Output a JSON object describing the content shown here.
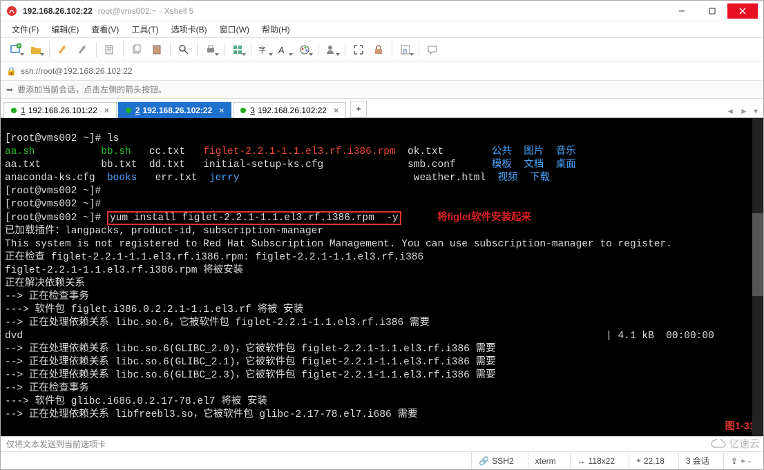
{
  "titlebar": {
    "main": "192.168.26.102:22",
    "sub": "root@vms002:~ - Xshell 5"
  },
  "menu": {
    "file": "文件(F)",
    "edit": "编辑(E)",
    "view": "查看(V)",
    "tools": "工具(T)",
    "tabs": "选项卡(B)",
    "window": "窗口(W)",
    "help": "帮助(H)"
  },
  "addr": {
    "url": "ssh://root@192.168.26.102:22"
  },
  "hint": {
    "text": "要添加当前会话，点击左侧的箭头按钮。"
  },
  "tabs": {
    "items": [
      {
        "num": "1",
        "label": "192.168.26.101:22"
      },
      {
        "num": "2",
        "label": "192.168.26.102:22"
      },
      {
        "num": "3",
        "label": "192.168.26.102:22"
      }
    ]
  },
  "term": {
    "prompt": "[root@vms002 ~]#",
    "cmd_ls": "ls",
    "row1": {
      "c1": "aa.sh",
      "c2": "bb.sh",
      "c3": "cc.txt",
      "c4": "figlet-2.2.1-1.1.el3.rf.i386.rpm",
      "c5": "ok.txt",
      "c6": "公共",
      "c7": "图片",
      "c8": "音乐"
    },
    "row2": {
      "c1": "aa.txt",
      "c2": "bb.txt",
      "c3": "dd.txt",
      "c4": "initial-setup-ks.cfg",
      "c5": "smb.conf",
      "c6": "模板",
      "c7": "文档",
      "c8": "桌面"
    },
    "row3": {
      "c1": "anaconda-ks.cfg",
      "c2": "books",
      "c3": "err.txt",
      "c4": "jerry",
      "c5": "weather.html",
      "c6": "视频",
      "c7": "下载"
    },
    "yum_cmd": "yum install figlet-2.2.1-1.1.el3.rf.i386.rpm  -y",
    "annot": "将figlet软件安装起来",
    "lines": [
      "已加载插件：langpacks, product-id, subscription-manager",
      "This system is not registered to Red Hat Subscription Management. You can use subscription-manager to register.",
      "正在检查 figlet-2.2.1-1.1.el3.rf.i386.rpm: figlet-2.2.1-1.1.el3.rf.i386",
      "figlet-2.2.1-1.1.el3.rf.i386.rpm 将被安装",
      "正在解决依赖关系",
      "--> 正在检查事务",
      "---> 软件包 figlet.i386.0.2.2.1-1.1.el3.rf 将被 安装",
      "--> 正在处理依赖关系 libc.so.6，它被软件包 figlet-2.2.1-1.1.el3.rf.i386 需要"
    ],
    "dvd_left": "dvd",
    "dvd_right": "| 4.1 kB  00:00:00",
    "lines2": [
      "--> 正在处理依赖关系 libc.so.6(GLIBC_2.0)，它被软件包 figlet-2.2.1-1.1.el3.rf.i386 需要",
      "--> 正在处理依赖关系 libc.so.6(GLIBC_2.1)，它被软件包 figlet-2.2.1-1.1.el3.rf.i386 需要",
      "--> 正在处理依赖关系 libc.so.6(GLIBC_2.3)，它被软件包 figlet-2.2.1-1.1.el3.rf.i386 需要",
      "--> 正在检查事务",
      "---> 软件包 glibc.i686.0.2.17-78.el7 将被 安装",
      "--> 正在处理依赖关系 libfreebl3.so，它被软件包 glibc-2.17-78.el7.i686 需要"
    ],
    "figlabel": "图1-31"
  },
  "sendhint": {
    "text": "仅将文本发送到当前选项卡"
  },
  "status": {
    "proto": "SSH2",
    "term": "xterm",
    "size": "118x22",
    "cursor": "22,18",
    "sessions": "3 会话"
  },
  "watermark": {
    "text": "亿速云"
  }
}
